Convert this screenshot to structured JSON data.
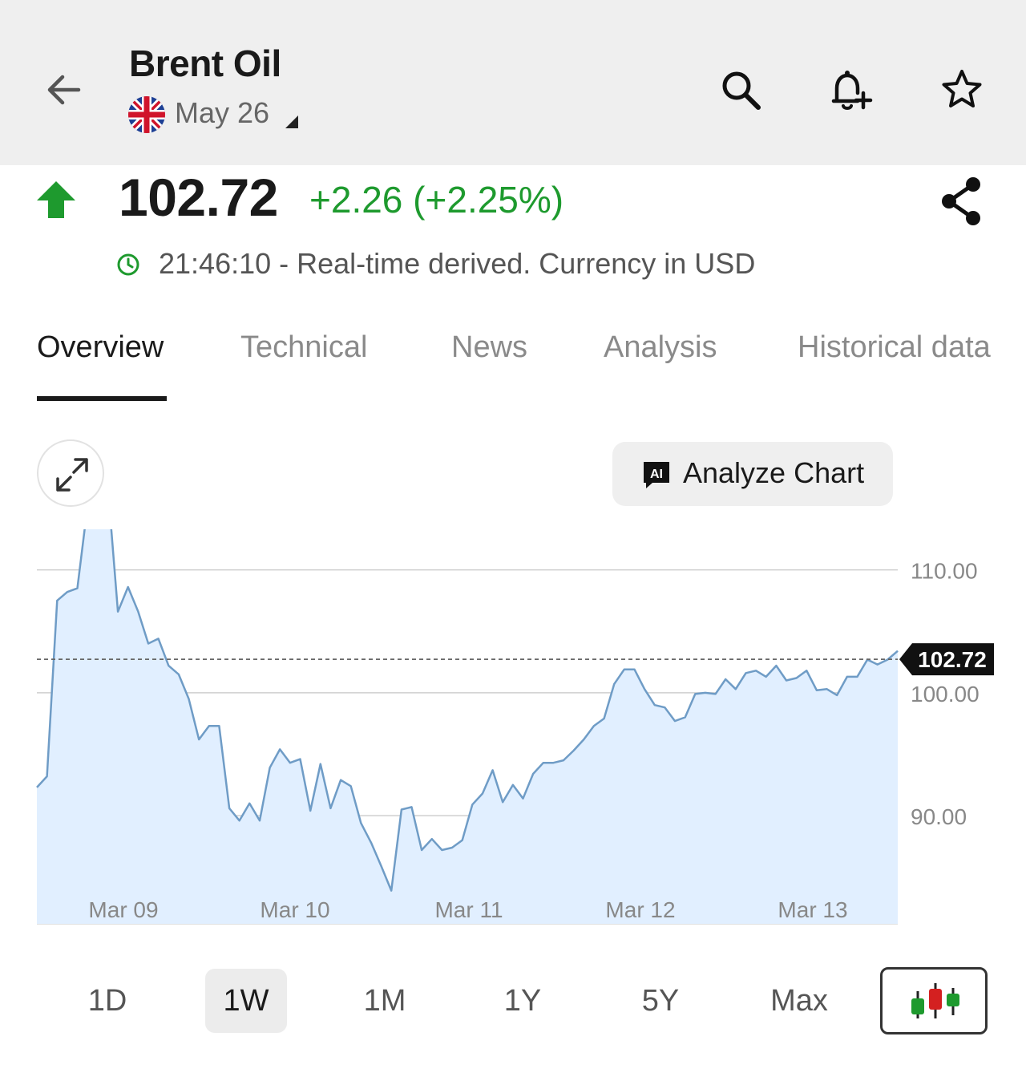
{
  "header": {
    "title": "Brent Oil",
    "contract": "May 26",
    "back_icon": "arrow-left-icon",
    "icons": [
      "search-icon",
      "bell-plus-icon",
      "star-icon"
    ]
  },
  "quote": {
    "price": "102.72",
    "change": "+2.26 (+2.25%)",
    "time_info": "21:46:10 - Real-time derived. Currency in USD",
    "up_color": "#1e9a2e"
  },
  "tabs": [
    "Overview",
    "Technical",
    "News",
    "Analysis",
    "Historical data"
  ],
  "active_tab": "Overview",
  "chart_controls": {
    "analyze_label": "Analyze Chart",
    "ai_badge": "AI"
  },
  "chart_data": {
    "type": "area",
    "x_labels": [
      "Mar 09",
      "Mar 10",
      "Mar 11",
      "Mar 12",
      "Mar 13"
    ],
    "y_ticks": [
      "90.00",
      "100.00",
      "110.00"
    ],
    "ylim": [
      81.2,
      113.3
    ],
    "current_value": 102.72,
    "current_label": "102.72",
    "line_color": "#6f9cc6",
    "fill_color": "#e1efff",
    "values": [
      92.3,
      93.2,
      107.5,
      108.2,
      108.5,
      115.2,
      116.7,
      116.9,
      106.6,
      108.6,
      106.6,
      104.0,
      104.4,
      102.2,
      101.5,
      99.5,
      96.2,
      97.3,
      97.3,
      90.6,
      89.6,
      91.0,
      89.6,
      93.9,
      95.4,
      94.3,
      94.6,
      90.4,
      94.2,
      90.6,
      92.9,
      92.4,
      89.4,
      87.8,
      85.9,
      83.9,
      90.5,
      90.7,
      87.2,
      88.1,
      87.2,
      87.4,
      88.0,
      90.9,
      91.8,
      93.7,
      91.1,
      92.5,
      91.4,
      93.4,
      94.3,
      94.3,
      94.5,
      95.3,
      96.2,
      97.3,
      97.9,
      100.7,
      101.9,
      101.9,
      100.3,
      99.0,
      98.8,
      97.7,
      98.0,
      99.9,
      100.0,
      99.9,
      101.1,
      100.3,
      101.6,
      101.8,
      101.3,
      102.2,
      101.0,
      101.2,
      101.8,
      100.2,
      100.3,
      99.8,
      101.3,
      101.3,
      102.7,
      102.3,
      102.7,
      103.4
    ]
  },
  "time_ranges": [
    "1D",
    "1W",
    "1M",
    "1Y",
    "5Y",
    "Max"
  ],
  "active_range": "1W",
  "candlestick_toggle": "candlestick-icon",
  "candle_colors": {
    "up": "#1e9a2e",
    "down": "#d42020"
  }
}
